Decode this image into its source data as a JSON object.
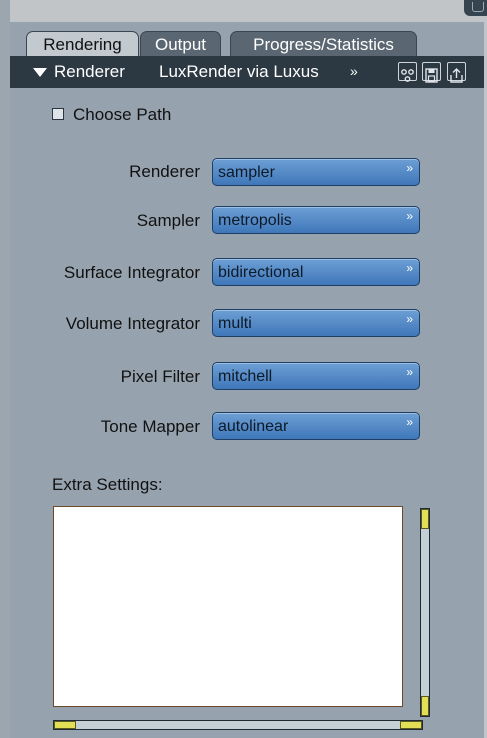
{
  "tabs": [
    {
      "label": "Rendering",
      "active": true
    },
    {
      "label": "Output",
      "active": false
    },
    {
      "label": "Progress/Statistics",
      "active": false
    }
  ],
  "titlebar": {
    "label": "Renderer",
    "value": "LuxRender via Luxus",
    "chevron": "»",
    "icons": [
      "settings-tree-icon",
      "save-icon",
      "export-icon"
    ]
  },
  "choose_path": {
    "label": "Choose Path",
    "checked": false
  },
  "rows": [
    {
      "label": "Renderer",
      "value": "sampler"
    },
    {
      "label": "Sampler",
      "value": "metropolis"
    },
    {
      "label": "Surface Integrator",
      "value": "bidirectional"
    },
    {
      "label": "Volume Integrator",
      "value": "multi"
    },
    {
      "label": "Pixel Filter",
      "value": "mitchell"
    },
    {
      "label": "Tone Mapper",
      "value": "autolinear"
    }
  ],
  "select_chevron": "»",
  "extra_settings": {
    "label": "Extra Settings:",
    "value": ""
  },
  "colors": {
    "panel": "#96a3ae",
    "titlebar": "#2c3842",
    "select": "#4f87c6",
    "scroll_thumb": "#e2de55"
  }
}
